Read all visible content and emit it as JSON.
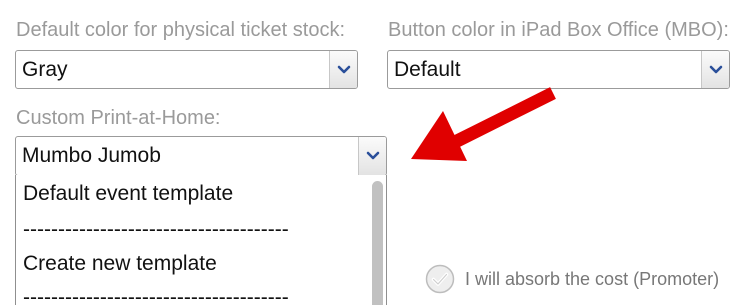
{
  "physical_ticket": {
    "label": "Default color for physical ticket stock:",
    "value": "Gray"
  },
  "ipad_button": {
    "label": "Button color in iPad Box Office (MBO):",
    "value": "Default"
  },
  "print_at_home": {
    "label": "Custom Print-at-Home:",
    "value": "Mumbo Jumob",
    "options": [
      "Default event template",
      "--------------------------------------",
      "Create new template",
      "--------------------------------------"
    ]
  },
  "absorb_cost": {
    "label": "I will absorb the cost (Promoter)",
    "checked": false
  },
  "icons": {
    "select_arrow": "chevron-down-icon",
    "annotation": "red-arrow-icon",
    "checkbox": "checkmark-circle-icon"
  },
  "colors": {
    "annotation_arrow": "#e00000",
    "chevron": "#2a4f9a",
    "label_text": "#9a9a9a"
  }
}
